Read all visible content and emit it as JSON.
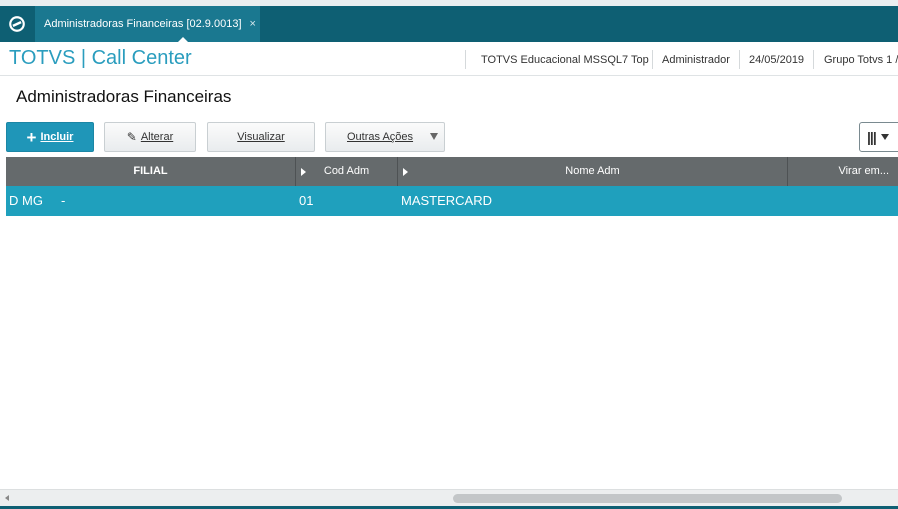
{
  "tab": {
    "title": "Administradoras Financeiras [02.9.0013]",
    "close": "×"
  },
  "header": {
    "app_title": "TOTVS | Call Center",
    "environment": "TOTVS Educacional MSSQL7 Top",
    "user": "Administrador",
    "date": "24/05/2019",
    "company": "Grupo Totvs 1 /"
  },
  "page": {
    "title": "Administradoras Financeiras"
  },
  "toolbar": {
    "incluir": "Incluir",
    "alterar": "Alterar",
    "visualizar": "Visualizar",
    "outras_acoes": "Outras Ações"
  },
  "grid": {
    "columns": [
      "FILIAL",
      "Cod Adm",
      "Nome Adm",
      "Virar em..."
    ],
    "rows": [
      {
        "filial": "D MG",
        "filial_desc": "-",
        "cod_adm": "01",
        "nome_adm": "MASTERCARD"
      }
    ]
  },
  "icons": {
    "logo": "totvs-logo-icon",
    "columns": "columns-icon"
  },
  "colors": {
    "topbar": "#0e5f73",
    "tab": "#1a7890",
    "accent": "#2a9dbe",
    "primary_button": "#1f96b8",
    "selected_row": "#1fa0bd",
    "grid_header": "#656a6c"
  }
}
